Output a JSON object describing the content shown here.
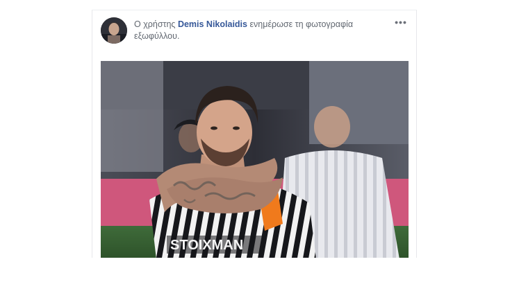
{
  "post": {
    "prefix": "Ο χρήστης",
    "author": "Demis Nikolaidis",
    "action": "ενημέρωσε τη φωτογραφία εξωφύλλου.",
    "more_menu": "•••"
  },
  "photo": {
    "shirt_text": "STOIXMAN"
  },
  "icons": {
    "avatar": "user-avatar",
    "more": "more-options-icon"
  }
}
